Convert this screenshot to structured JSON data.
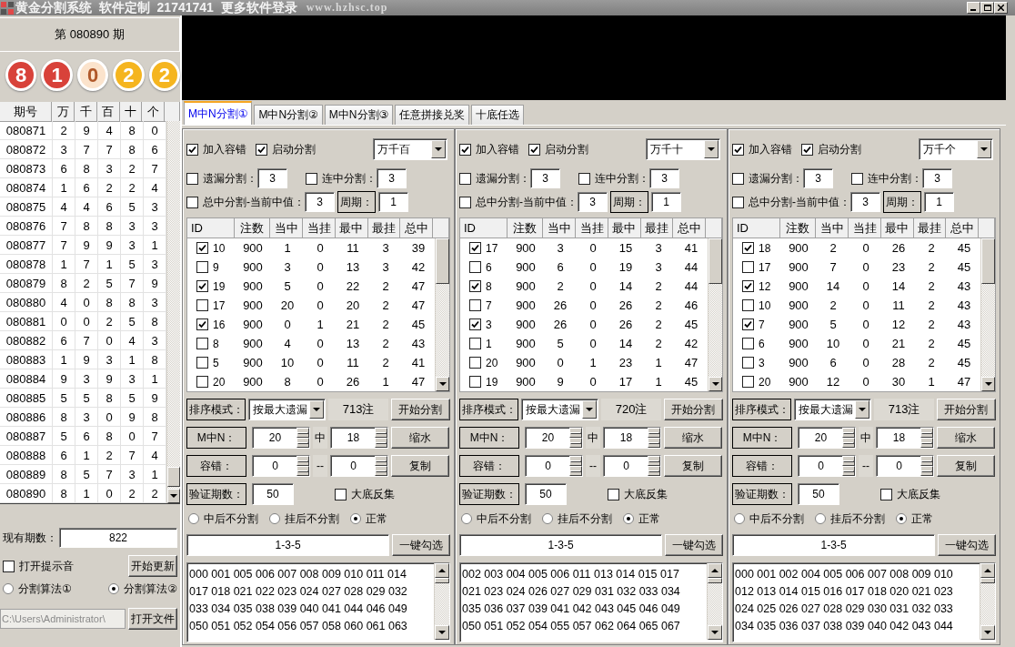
{
  "window": {
    "title": "黄金分割系统  软件定制  21741741  更多软件登录",
    "site": "www.hzhsc.top"
  },
  "left_panel": {
    "period": "第 080890 期",
    "balls": [
      {
        "text": "8",
        "color": "#d8423a"
      },
      {
        "text": "1",
        "color": "#d8423a"
      },
      {
        "text": "0",
        "color": "#fbe3cc"
      },
      {
        "text": "2",
        "color": "#f5b51f"
      },
      {
        "text": "2",
        "color": "#f5b51f"
      }
    ],
    "history": {
      "columns": [
        "期号",
        "万",
        "千",
        "百",
        "十",
        "个"
      ],
      "rows": [
        [
          "080871",
          "2",
          "9",
          "4",
          "8",
          "0"
        ],
        [
          "080872",
          "3",
          "7",
          "7",
          "8",
          "6"
        ],
        [
          "080873",
          "6",
          "8",
          "3",
          "2",
          "7"
        ],
        [
          "080874",
          "1",
          "6",
          "2",
          "2",
          "4"
        ],
        [
          "080875",
          "4",
          "4",
          "6",
          "5",
          "3"
        ],
        [
          "080876",
          "7",
          "8",
          "8",
          "3",
          "3"
        ],
        [
          "080877",
          "7",
          "9",
          "9",
          "3",
          "1"
        ],
        [
          "080878",
          "1",
          "7",
          "1",
          "5",
          "3"
        ],
        [
          "080879",
          "8",
          "2",
          "5",
          "7",
          "9"
        ],
        [
          "080880",
          "4",
          "0",
          "8",
          "8",
          "3"
        ],
        [
          "080881",
          "0",
          "0",
          "2",
          "5",
          "8"
        ],
        [
          "080882",
          "6",
          "7",
          "0",
          "4",
          "3"
        ],
        [
          "080883",
          "1",
          "9",
          "3",
          "1",
          "8"
        ],
        [
          "080884",
          "9",
          "3",
          "9",
          "3",
          "1"
        ],
        [
          "080885",
          "5",
          "5",
          "8",
          "5",
          "9"
        ],
        [
          "080886",
          "8",
          "3",
          "0",
          "9",
          "8"
        ],
        [
          "080887",
          "5",
          "6",
          "8",
          "0",
          "7"
        ],
        [
          "080888",
          "6",
          "1",
          "2",
          "7",
          "4"
        ],
        [
          "080889",
          "8",
          "5",
          "7",
          "3",
          "1"
        ],
        [
          "080890",
          "8",
          "1",
          "0",
          "2",
          "2"
        ]
      ]
    },
    "count_label": "现有期数：",
    "count_value": "822",
    "sound": {
      "label": "打开提示音",
      "checked": false
    },
    "update_button": "开始更新",
    "algorithms": [
      {
        "label": "分割算法①",
        "selected": false
      },
      {
        "label": "分割算法②",
        "selected": true
      }
    ],
    "path": "C:\\Users\\Administrator\\",
    "open_button": "打开文件"
  },
  "tabs": [
    {
      "label": "M中N分割①",
      "selected": true
    },
    {
      "label": "M中N分割②",
      "selected": false
    },
    {
      "label": "M中N分割③",
      "selected": false
    },
    {
      "label": "任意拼接兑奖",
      "selected": false
    },
    {
      "label": "十底任选",
      "selected": false
    }
  ],
  "panels": [
    {
      "checks": [
        {
          "label": "加入容错",
          "checked": true
        },
        {
          "label": "启动分割",
          "checked": true
        }
      ],
      "position": "万千百",
      "miss": {
        "label": "遗漏分割：",
        "checked": false,
        "value": "3"
      },
      "streak": {
        "label": "连中分割：",
        "checked": false,
        "value": "3"
      },
      "total": {
        "label": "总中分割-当前中值：",
        "checked": false,
        "value": "3"
      },
      "cycle": {
        "label": "周期：",
        "value": "1"
      },
      "table": {
        "columns": [
          "ID",
          "注数",
          "当中",
          "当挂",
          "最中",
          "最挂",
          "总中"
        ],
        "rows": [
          {
            "checked": true,
            "cells": [
              "10",
              "900",
              "1",
              "0",
              "11",
              "3",
              "39"
            ]
          },
          {
            "checked": false,
            "cells": [
              "9",
              "900",
              "3",
              "0",
              "13",
              "3",
              "42"
            ]
          },
          {
            "checked": true,
            "cells": [
              "19",
              "900",
              "5",
              "0",
              "22",
              "2",
              "47"
            ]
          },
          {
            "checked": false,
            "cells": [
              "17",
              "900",
              "20",
              "0",
              "20",
              "2",
              "47"
            ]
          },
          {
            "checked": true,
            "cells": [
              "16",
              "900",
              "0",
              "1",
              "21",
              "2",
              "45"
            ]
          },
          {
            "checked": false,
            "cells": [
              "8",
              "900",
              "4",
              "0",
              "13",
              "2",
              "43"
            ]
          },
          {
            "checked": false,
            "cells": [
              "5",
              "900",
              "10",
              "0",
              "11",
              "2",
              "41"
            ]
          },
          {
            "checked": false,
            "cells": [
              "20",
              "900",
              "8",
              "0",
              "26",
              "1",
              "47"
            ]
          }
        ]
      },
      "sort": {
        "label": "排序模式：",
        "mode": "按最大遗漏",
        "count": "713注",
        "button": "开始分割"
      },
      "mn": {
        "label": "M中N：",
        "m": "20",
        "sep": "中",
        "n": "18",
        "button": "缩水"
      },
      "tolerance": {
        "label": "容错：",
        "from": "0",
        "sep": "--",
        "to": "0",
        "button": "复制"
      },
      "verify": {
        "label": "验证期数：",
        "value": "50",
        "inverse": {
          "label": "大底反集",
          "checked": false
        }
      },
      "modes": [
        {
          "label": "中后不分割",
          "selected": false
        },
        {
          "label": "挂后不分割",
          "selected": false
        },
        {
          "label": "正常",
          "selected": true
        }
      ],
      "pattern": "1-3-5",
      "pick_button": "一键勾选",
      "numbers": [
        "000 001 005 006 007 008 009 010 011 014",
        "017 018 021 022 023 024 027 028 029 032",
        "033 034 035 038 039 040 041 044 046 049",
        "050 051 052 054 056 057 058 060 061 063"
      ]
    },
    {
      "checks": [
        {
          "label": "加入容错",
          "checked": true
        },
        {
          "label": "启动分割",
          "checked": true
        }
      ],
      "position": "万千十",
      "miss": {
        "label": "遗漏分割：",
        "checked": false,
        "value": "3"
      },
      "streak": {
        "label": "连中分割：",
        "checked": false,
        "value": "3"
      },
      "total": {
        "label": "总中分割-当前中值：",
        "checked": false,
        "value": "3"
      },
      "cycle": {
        "label": "周期：",
        "value": "1"
      },
      "table": {
        "columns": [
          "ID",
          "注数",
          "当中",
          "当挂",
          "最中",
          "最挂",
          "总中"
        ],
        "rows": [
          {
            "checked": true,
            "cells": [
              "17",
              "900",
              "3",
              "0",
              "15",
              "3",
              "41"
            ]
          },
          {
            "checked": false,
            "cells": [
              "6",
              "900",
              "6",
              "0",
              "19",
              "3",
              "44"
            ]
          },
          {
            "checked": true,
            "cells": [
              "8",
              "900",
              "2",
              "0",
              "14",
              "2",
              "44"
            ]
          },
          {
            "checked": false,
            "cells": [
              "7",
              "900",
              "26",
              "0",
              "26",
              "2",
              "46"
            ]
          },
          {
            "checked": true,
            "cells": [
              "3",
              "900",
              "26",
              "0",
              "26",
              "2",
              "45"
            ]
          },
          {
            "checked": false,
            "cells": [
              "1",
              "900",
              "5",
              "0",
              "14",
              "2",
              "42"
            ]
          },
          {
            "checked": false,
            "cells": [
              "20",
              "900",
              "0",
              "1",
              "23",
              "1",
              "47"
            ]
          },
          {
            "checked": false,
            "cells": [
              "19",
              "900",
              "9",
              "0",
              "17",
              "1",
              "45"
            ]
          }
        ]
      },
      "sort": {
        "label": "排序模式：",
        "mode": "按最大遗漏",
        "count": "720注",
        "button": "开始分割"
      },
      "mn": {
        "label": "M中N：",
        "m": "20",
        "sep": "中",
        "n": "18",
        "button": "缩水"
      },
      "tolerance": {
        "label": "容错：",
        "from": "0",
        "sep": "--",
        "to": "0",
        "button": "复制"
      },
      "verify": {
        "label": "验证期数：",
        "value": "50",
        "inverse": {
          "label": "大底反集",
          "checked": false
        }
      },
      "modes": [
        {
          "label": "中后不分割",
          "selected": false
        },
        {
          "label": "挂后不分割",
          "selected": false
        },
        {
          "label": "正常",
          "selected": true
        }
      ],
      "pattern": "1-3-5",
      "pick_button": "一键勾选",
      "numbers": [
        "002 003 004 005 006 011 013 014 015 017",
        "021 023 024 026 027 029 031 032 033 034",
        "035 036 037 039 041 042 043 045 046 049",
        "050 051 052 054 055 057 062 064 065 067"
      ]
    },
    {
      "checks": [
        {
          "label": "加入容错",
          "checked": true
        },
        {
          "label": "启动分割",
          "checked": true
        }
      ],
      "position": "万千个",
      "miss": {
        "label": "遗漏分割：",
        "checked": false,
        "value": "3"
      },
      "streak": {
        "label": "连中分割：",
        "checked": false,
        "value": "3"
      },
      "total": {
        "label": "总中分割-当前中值：",
        "checked": false,
        "value": "3"
      },
      "cycle": {
        "label": "周期：",
        "value": "1"
      },
      "table": {
        "columns": [
          "ID",
          "注数",
          "当中",
          "当挂",
          "最中",
          "最挂",
          "总中"
        ],
        "rows": [
          {
            "checked": true,
            "cells": [
              "18",
              "900",
              "2",
              "0",
              "26",
              "2",
              "45"
            ]
          },
          {
            "checked": false,
            "cells": [
              "17",
              "900",
              "7",
              "0",
              "23",
              "2",
              "45"
            ]
          },
          {
            "checked": true,
            "cells": [
              "12",
              "900",
              "14",
              "0",
              "14",
              "2",
              "43"
            ]
          },
          {
            "checked": false,
            "cells": [
              "10",
              "900",
              "2",
              "0",
              "11",
              "2",
              "43"
            ]
          },
          {
            "checked": true,
            "cells": [
              "7",
              "900",
              "5",
              "0",
              "12",
              "2",
              "43"
            ]
          },
          {
            "checked": false,
            "cells": [
              "6",
              "900",
              "10",
              "0",
              "21",
              "2",
              "45"
            ]
          },
          {
            "checked": false,
            "cells": [
              "3",
              "900",
              "6",
              "0",
              "28",
              "2",
              "45"
            ]
          },
          {
            "checked": false,
            "cells": [
              "20",
              "900",
              "12",
              "0",
              "30",
              "1",
              "47"
            ]
          }
        ]
      },
      "sort": {
        "label": "排序模式：",
        "mode": "按最大遗漏",
        "count": "713注",
        "button": "开始分割"
      },
      "mn": {
        "label": "M中N：",
        "m": "20",
        "sep": "中",
        "n": "18",
        "button": "缩水"
      },
      "tolerance": {
        "label": "容错：",
        "from": "0",
        "sep": "--",
        "to": "0",
        "button": "复制"
      },
      "verify": {
        "label": "验证期数：",
        "value": "50",
        "inverse": {
          "label": "大底反集",
          "checked": false
        }
      },
      "modes": [
        {
          "label": "中后不分割",
          "selected": false
        },
        {
          "label": "挂后不分割",
          "selected": false
        },
        {
          "label": "正常",
          "selected": true
        }
      ],
      "pattern": "1-3-5",
      "pick_button": "一键勾选",
      "numbers": [
        "000 001 002 004 005 006 007 008 009 010",
        "012 013 014 015 016 017 018 020 021 023",
        "024 025 026 027 028 029 030 031 032 033",
        "034 035 036 037 038 039 040 042 043 044"
      ]
    }
  ]
}
